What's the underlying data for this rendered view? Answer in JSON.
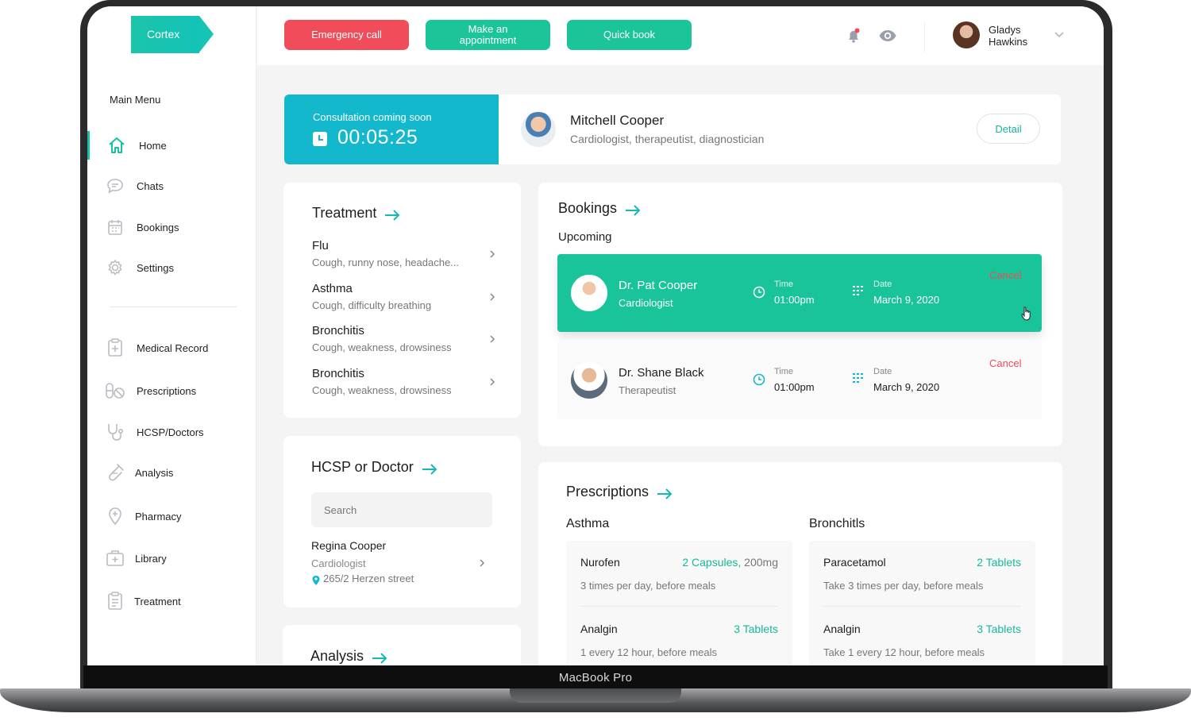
{
  "brand": {
    "logo": "Cortex",
    "device_label": "MacBook Pro"
  },
  "sidebar": {
    "menu_title": "Main Menu",
    "items": [
      {
        "label": "Home",
        "icon": "home-icon",
        "active": true
      },
      {
        "label": "Chats",
        "icon": "chat-icon"
      },
      {
        "label": "Bookings",
        "icon": "calendar-icon"
      },
      {
        "label": "Settings",
        "icon": "gear-icon"
      },
      {
        "label": "Medical Record",
        "icon": "medical-record-icon"
      },
      {
        "label": "Prescriptions",
        "icon": "pills-icon"
      },
      {
        "label": "HCSP/Doctors",
        "icon": "stethoscope-icon"
      },
      {
        "label": "Analysis",
        "icon": "test-tube-icon"
      },
      {
        "label": "Pharmacy",
        "icon": "location-pin-icon"
      },
      {
        "label": "Library",
        "icon": "first-aid-kit-icon"
      },
      {
        "label": "Treatment",
        "icon": "clipboard-icon"
      }
    ]
  },
  "topbar": {
    "emergency_label": "Emergency call",
    "appointment_label": "Make an appointment",
    "quickbook_label": "Quick book",
    "user_name": "Gladys Hawkins"
  },
  "consultation": {
    "label": "Consultation coming soon",
    "countdown": "00:05:25",
    "doctor_name": "Mitchell Cooper",
    "doctor_specialty": "Cardiologist, therapeutist, diagnostician",
    "detail_label": "Detail"
  },
  "treatment": {
    "title": "Treatment",
    "items": [
      {
        "name": "Flu",
        "desc": "Cough, runny nose, headache..."
      },
      {
        "name": "Asthma",
        "desc": "Cough, difficulty breathing"
      },
      {
        "name": "Bronchitis",
        "desc": "Cough, weakness, drowsiness"
      },
      {
        "name": "Bronchitis",
        "desc": "Cough, weakness, drowsiness"
      }
    ]
  },
  "hcsp": {
    "title": "HCSP or Doctor",
    "search_placeholder": "Search",
    "result": {
      "name": "Regina Cooper",
      "specialty": "Cardiologist",
      "address": "265/2 Herzen street"
    }
  },
  "analysis": {
    "title": "Analysis"
  },
  "bookings": {
    "title": "Bookings",
    "subtitle": "Upcoming",
    "items": [
      {
        "doctor": "Dr. Pat Cooper",
        "role": "Cardiologist",
        "time_label": "Time",
        "time": "01:00pm",
        "date_label": "Date",
        "date": "March 9, 2020",
        "cancel": "Cancel",
        "highlighted": true
      },
      {
        "doctor": "Dr. Shane Black",
        "role": "Therapeutist",
        "time_label": "Time",
        "time": "01:00pm",
        "date_label": "Date",
        "date": "March 9, 2020",
        "cancel": "Cancel",
        "highlighted": false
      }
    ]
  },
  "prescriptions": {
    "title": "Prescriptions",
    "groups": [
      {
        "condition": "Asthma",
        "meds": [
          {
            "name": "Nurofen",
            "qty": "2 Capsules,",
            "dose": " 200mg",
            "note": "3 times per day, before meals"
          },
          {
            "name": "Analgin",
            "qty": "3 Tablets",
            "dose": "",
            "note": "1 every 12 hour, before meals"
          }
        ]
      },
      {
        "condition": "Bronchitls",
        "meds": [
          {
            "name": "Paracetamol",
            "qty": "2 Tablets",
            "dose": "",
            "note": "Take 3 times per day, before meals"
          },
          {
            "name": "Analgin",
            "qty": "3 Tablets",
            "dose": "",
            "note": "Take 1 every 12 hour, before meals"
          }
        ]
      }
    ]
  },
  "colors": {
    "accent": "#1bc499",
    "teal": "#14b8cc",
    "danger": "#f04c5a"
  }
}
